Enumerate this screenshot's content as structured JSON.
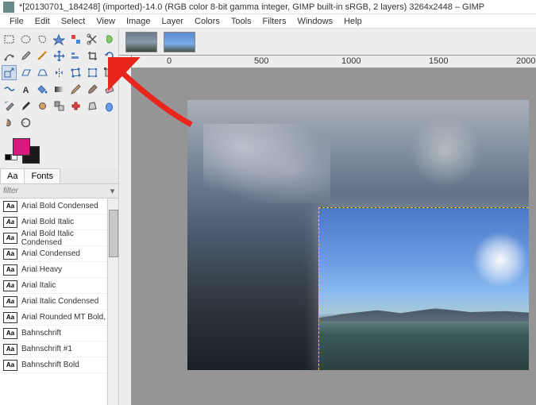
{
  "title": "*[20130701_184248] (imported)-14.0 (RGB color 8-bit gamma integer, GIMP built-in sRGB, 2 layers) 3264x2448 – GIMP",
  "menu": [
    "File",
    "Edit",
    "Select",
    "View",
    "Image",
    "Layer",
    "Colors",
    "Tools",
    "Filters",
    "Windows",
    "Help"
  ],
  "tools": [
    "rect-select",
    "ellipse-select",
    "free-select",
    "fuzzy-select",
    "color-select",
    "scissors",
    "foreground-select",
    "paths",
    "color-picker",
    "measure",
    "move",
    "align",
    "crop",
    "rotate",
    "scale",
    "shear",
    "perspective",
    "flip",
    "cage",
    "unified-transform",
    "handle-transform",
    "warp",
    "text",
    "bucket-fill",
    "gradient",
    "pencil",
    "paintbrush",
    "eraser",
    "airbrush",
    "ink",
    "mypaint",
    "clone",
    "heal",
    "perspective-clone",
    "blur",
    "smudge",
    "dodge",
    "",
    "",
    "",
    "",
    ""
  ],
  "colors": {
    "fg": "#d61a7f",
    "bg": "#1a1a1a"
  },
  "tabs": [
    {
      "label": "Aa",
      "active": true
    },
    {
      "label": "Fonts",
      "active": false
    }
  ],
  "filter_placeholder": "filter",
  "fonts": [
    {
      "name": "Arial Bold Condensed",
      "style": "b"
    },
    {
      "name": "Arial Bold Italic",
      "style": "bi"
    },
    {
      "name": "Arial Bold Italic Condensed",
      "style": "bi"
    },
    {
      "name": "Arial Condensed",
      "style": ""
    },
    {
      "name": "Arial Heavy",
      "style": "b"
    },
    {
      "name": "Arial Italic",
      "style": "i"
    },
    {
      "name": "Arial Italic Condensed",
      "style": "i"
    },
    {
      "name": "Arial Rounded MT Bold,",
      "style": "b"
    },
    {
      "name": "Bahnschrift",
      "style": ""
    },
    {
      "name": "Bahnschrift #1",
      "style": ""
    },
    {
      "name": "Bahnschrift Bold",
      "style": "b"
    }
  ],
  "ruler_marks": [
    {
      "pos": 60,
      "label": "0"
    },
    {
      "pos": 170,
      "label": "500"
    },
    {
      "pos": 280,
      "label": "1000"
    },
    {
      "pos": 390,
      "label": "1500"
    },
    {
      "pos": 500,
      "label": "2000"
    }
  ]
}
